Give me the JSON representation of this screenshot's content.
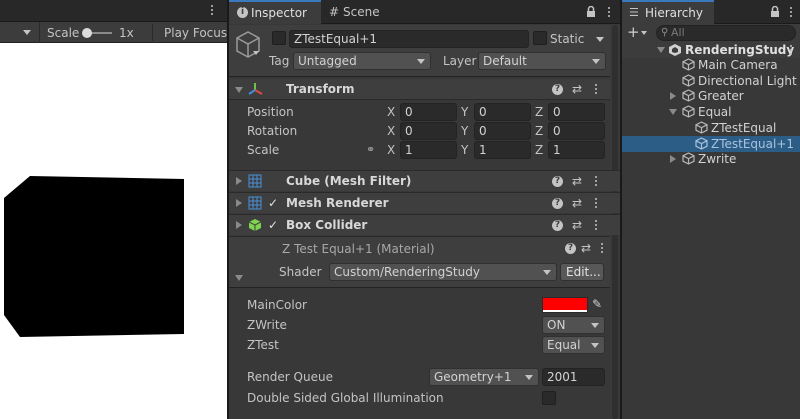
{
  "game": {
    "scale_label": "Scale",
    "scale_value": "1x",
    "play_focus_label": "Play Focus"
  },
  "inspector": {
    "tabs": [
      {
        "label": "Inspector",
        "icon": "info-icon"
      },
      {
        "label": "Scene",
        "icon": "hash-icon"
      }
    ],
    "object_name": "ZTestEqual+1",
    "static_label": "Static",
    "tag_label": "Tag",
    "tag_value": "Untagged",
    "layer_label": "Layer",
    "layer_value": "Default",
    "transform": {
      "title": "Transform",
      "rows": [
        {
          "label": "Position",
          "x": "0",
          "y": "0",
          "z": "0"
        },
        {
          "label": "Rotation",
          "x": "0",
          "y": "0",
          "z": "0"
        },
        {
          "label": "Scale",
          "x": "1",
          "y": "1",
          "z": "1"
        }
      ],
      "axis_x": "X",
      "axis_y": "Y",
      "axis_z": "Z"
    },
    "components": [
      {
        "title": "Cube (Mesh Filter)",
        "icon": "grid-icon",
        "checkbox": false
      },
      {
        "title": "Mesh Renderer",
        "icon": "mesh-renderer-icon",
        "checkbox": true
      },
      {
        "title": "Box Collider",
        "icon": "cube-green-icon",
        "checkbox": true
      }
    ],
    "material": {
      "title": "Z Test Equal+1 (Material)",
      "shader_label": "Shader",
      "shader_value": "Custom/RenderingStudy",
      "edit_label": "Edit...",
      "props": [
        {
          "label": "MainColor",
          "type": "color",
          "value": "#ff0000"
        },
        {
          "label": "ZWrite",
          "type": "dropdown",
          "value": "ON"
        },
        {
          "label": "ZTest",
          "type": "dropdown",
          "value": "Equal"
        }
      ],
      "render_queue_label": "Render Queue",
      "render_queue_dropdown": "Geometry+1",
      "render_queue_value": "2001",
      "dsgi_label": "Double Sided Global Illumination"
    }
  },
  "hierarchy": {
    "tab_label": "Hierarchy",
    "search_placeholder": "All",
    "root": "RenderingStudy",
    "items": [
      {
        "label": "Main Camera",
        "depth": 1,
        "fold": "none",
        "selected": false
      },
      {
        "label": "Directional Light",
        "depth": 1,
        "fold": "none",
        "selected": false
      },
      {
        "label": "Greater",
        "depth": 1,
        "fold": "collapsed",
        "selected": false
      },
      {
        "label": "Equal",
        "depth": 1,
        "fold": "expanded",
        "selected": false
      },
      {
        "label": "ZTestEqual",
        "depth": 2,
        "fold": "none",
        "selected": false
      },
      {
        "label": "ZTestEqual+1",
        "depth": 2,
        "fold": "none",
        "selected": true
      },
      {
        "label": "Zwrite",
        "depth": 1,
        "fold": "collapsed",
        "selected": false
      }
    ]
  },
  "colors": {
    "accent_selection": "#2c5d87",
    "main_color": "#ff0000"
  }
}
